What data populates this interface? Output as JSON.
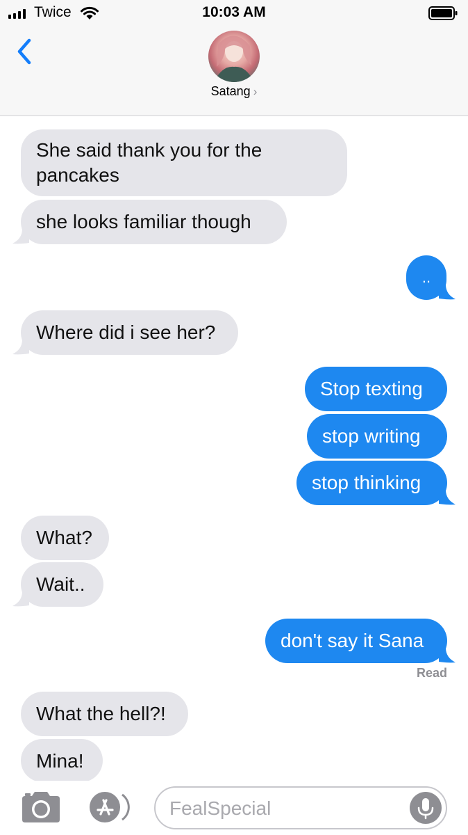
{
  "status_bar": {
    "carrier": "Twice",
    "time": "10:03 AM"
  },
  "header": {
    "contact_name": "Satang",
    "contact_chevron": "›",
    "back_icon": "chevron-left-icon"
  },
  "messages": [
    {
      "direction": "in",
      "lines": [
        "She said thank you for the",
        "pancakes"
      ]
    },
    {
      "direction": "in",
      "lines": [
        "she looks familiar though"
      ]
    },
    {
      "direction": "out",
      "lines": [
        ".."
      ]
    },
    {
      "direction": "in",
      "lines": [
        "Where did i see her?"
      ]
    },
    {
      "direction": "out",
      "lines": [
        "Stop texting"
      ]
    },
    {
      "direction": "out",
      "lines": [
        "stop writing"
      ]
    },
    {
      "direction": "out",
      "lines": [
        "stop thinking"
      ]
    },
    {
      "direction": "in",
      "lines": [
        "What?"
      ]
    },
    {
      "direction": "in",
      "lines": [
        "Wait.."
      ]
    },
    {
      "direction": "out",
      "lines": [
        "don't say it Sana"
      ]
    },
    {
      "direction": "in",
      "lines": [
        "What the hell?!"
      ]
    },
    {
      "direction": "in",
      "lines": [
        "Mina!"
      ]
    }
  ],
  "read_receipt": "Read",
  "input_bar": {
    "placeholder": "FealSpecial",
    "value": ""
  },
  "colors": {
    "incoming_bubble": "#e5e5ea",
    "outgoing_bubble": "#1e88f0",
    "ios_blue": "#147efb"
  }
}
